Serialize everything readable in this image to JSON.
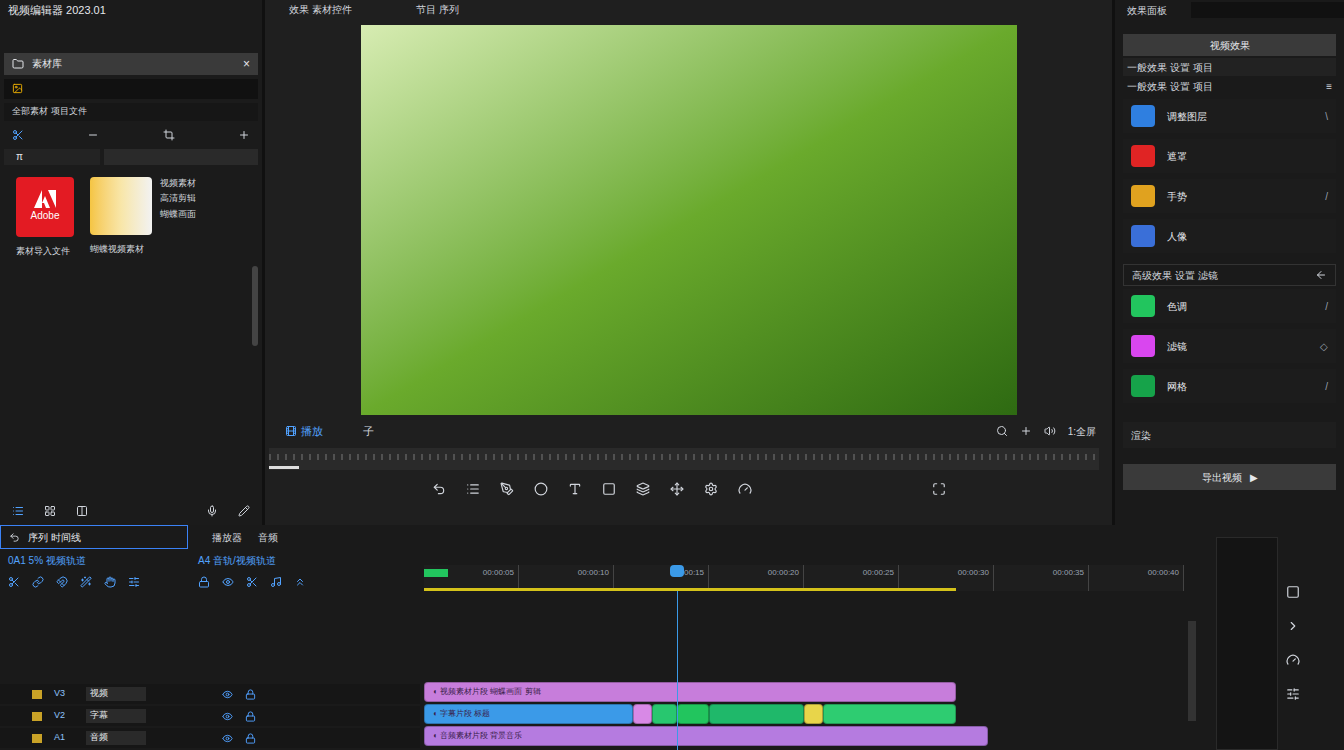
{
  "app": {
    "title": "视频编辑器 2023.01"
  },
  "media_panel": {
    "tab": "素材库",
    "close": "×",
    "filter": "全部素材 项目文件",
    "tabs": [
      {
        "label": "π",
        "selected": true
      },
      {
        "label": "",
        "selected": false
      }
    ],
    "items": [
      {
        "kind": "logo",
        "logo": "Adobe",
        "caption": "素材导入文件"
      },
      {
        "kind": "thumbnail",
        "caption": "蝴蝶视频素材",
        "details": [
          "视频素材",
          "高清剪辑",
          "蝴蝶画面"
        ]
      }
    ]
  },
  "preview": {
    "tabs": [
      "效果 素材控件",
      "节目 序列"
    ],
    "play_label": "播放",
    "mark": "子",
    "zoom": "1:全屏"
  },
  "effects_panel": {
    "title": "效果面板",
    "button": "视频效果",
    "section": "一般效果 设置 项目",
    "section_mark": "≡",
    "items": [
      {
        "label": "调整图层",
        "color": "#2f7fe0",
        "mark": "\\"
      },
      {
        "label": "遮罩",
        "color": "#e02424",
        "mark": ""
      },
      {
        "label": "手势",
        "color": "#e0a21f",
        "mark": "/"
      },
      {
        "label": "人像",
        "color": "#3a6fd8",
        "mark": ""
      }
    ],
    "section2": "高级效果 设置 滤镜",
    "items2": [
      {
        "label": "色调",
        "color": "#22c55e",
        "mark": "/"
      },
      {
        "label": "滤镜",
        "color": "#d946ef",
        "mark": "◇"
      },
      {
        "label": "网格",
        "color": "#16a34a",
        "mark": "/"
      }
    ],
    "render": "渲染",
    "export": "导出视频",
    "export_icon": "▶"
  },
  "timeline": {
    "title": "序列 时间线",
    "track_info": "0A1 5% 视频轨道",
    "tabs": [
      "播放器",
      "音频"
    ],
    "subheader": "A4 音轨/视频轨道",
    "duration": 40,
    "playhead": 13.3,
    "work_area": 28,
    "ruler": [
      "00:00:05",
      "00:00:10",
      "00:00:15",
      "00:00:20",
      "00:00:25",
      "00:00:30",
      "00:00:35",
      "00:00:40"
    ],
    "tracks": [
      {
        "name": "视频",
        "code": "V3",
        "clips": [
          {
            "label": "◐ 视频素材片段 蝴蝶画面 剪辑",
            "start": 0,
            "length": 28,
            "color": "#c77ddb"
          }
        ]
      },
      {
        "name": "字幕",
        "code": "V2",
        "clips": [
          {
            "label": "◐ 字幕片段 标题",
            "start": 0,
            "length": 11,
            "color": "#3b9ae8"
          },
          {
            "label": "",
            "start": 11,
            "length": 1,
            "color": "#d889e6"
          },
          {
            "label": "",
            "start": 12,
            "length": 1.3,
            "color": "#28c76f"
          },
          {
            "label": "",
            "start": 13.3,
            "length": 1.7,
            "color": "#22c55e"
          },
          {
            "label": "",
            "start": 15,
            "length": 5,
            "color": "#1fb86a"
          },
          {
            "label": "",
            "start": 20,
            "length": 1,
            "color": "#e8d54a"
          },
          {
            "label": "",
            "start": 21,
            "length": 7,
            "color": "#2ecc71"
          }
        ]
      },
      {
        "name": "音频",
        "code": "A1",
        "clips": [
          {
            "label": "◐ 音频素材片段 背景音乐",
            "start": 0,
            "length": 29.7,
            "color": "#b57be0"
          }
        ]
      }
    ]
  }
}
